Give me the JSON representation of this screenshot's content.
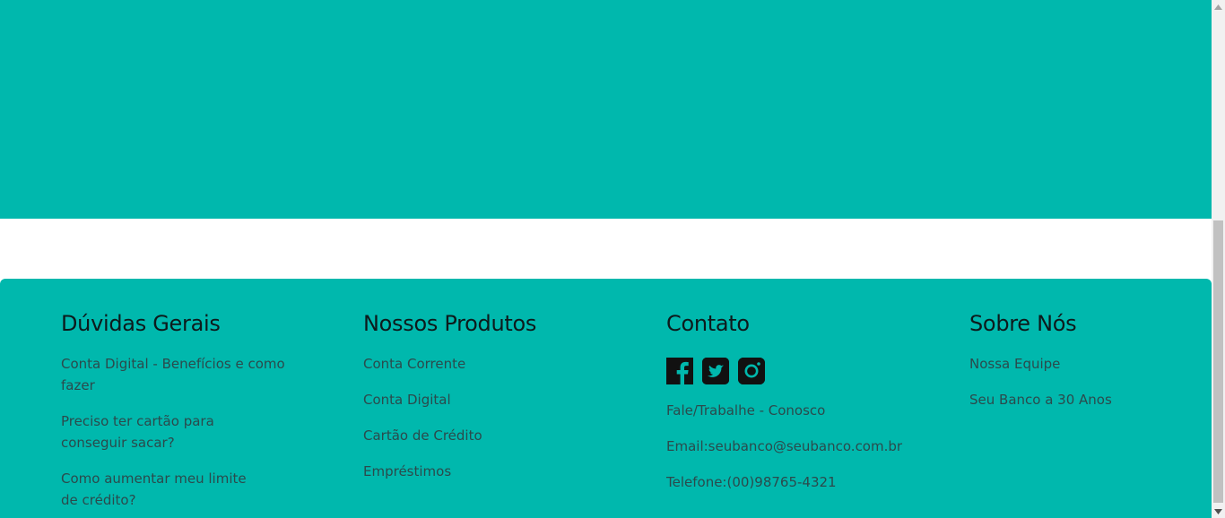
{
  "footer": {
    "duvidas": {
      "title": "Dúvidas Gerais",
      "items": [
        "Conta Digital - Benefícios e como fazer",
        "Preciso ter cartão para conseguir sacar?",
        "Como aumentar meu limite de crédito?"
      ]
    },
    "produtos": {
      "title": "Nossos Produtos",
      "items": [
        "Conta Corrente",
        "Conta Digital",
        "Cartão de Crédito",
        "Empréstimos"
      ]
    },
    "contato": {
      "title": "Contato",
      "social_icons": [
        "facebook-icon",
        "twitter-icon",
        "instagram-icon"
      ],
      "items": [
        "Fale/Trabalhe - Conosco",
        "Email:seubanco@seubanco.com.br",
        "Telefone:(00)98765-4321"
      ]
    },
    "sobre": {
      "title": "Sobre Nós",
      "items": [
        "Nossa Equipe",
        "Seu Banco a 30 Anos"
      ]
    }
  },
  "colors": {
    "brand_teal": "#00b8ad",
    "heading_text": "#0d1a1c",
    "link_text": "#2b4a4c"
  }
}
